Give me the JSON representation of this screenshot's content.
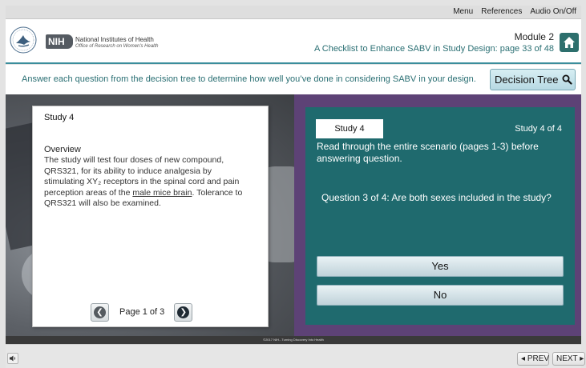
{
  "topbar": {
    "menu": "Menu",
    "references": "References",
    "audio": "Audio On/Off"
  },
  "header": {
    "nih_badge": "NIH",
    "nih_name": "National Institutes of Health",
    "nih_office": "Office of Research on Women's Health",
    "module": "Module 2",
    "page_title": "A Checklist to Enhance SABV in Study Design: page 33 of 48",
    "home_icon": "home-icon"
  },
  "instruction": {
    "text": "Answer each question from the decision tree to determine how well you’ve done in considering SABV in your design.",
    "decision_tree_label": "Decision Tree",
    "search_icon": "search-icon"
  },
  "study_card": {
    "title": "Study 4",
    "overview_heading": "Overview",
    "body_before": "The study will test four doses of new compound, QRS321, for its ability to induce analgesia by stimulating XY₂ receptors in the spinal cord and pain perception areas of the ",
    "body_link": "male mice brain",
    "body_after": ". Tolerance to QRS321 will also be examined.",
    "pager": {
      "label": "Page 1 of 3",
      "current_page": 1,
      "total_pages": 3
    }
  },
  "question_panel": {
    "tab_label": "Study 4",
    "study_count": "Study 4  of  4",
    "scenario_text": "Read through the entire scenario (pages 1-3) before answering question.",
    "question_text": "Question 3 of 4: Are both sexes included in the study?",
    "answers": [
      "Yes",
      "No"
    ]
  },
  "footer": {
    "copyright": "©2017 NIH...Turning Discovery Into Health",
    "prev_label": "PREV",
    "next_label": "NEXT"
  },
  "colors": {
    "teal_panel": "#1f6a6e",
    "purple_frame": "#5d4276",
    "header_text_teal": "#2a6f73"
  }
}
